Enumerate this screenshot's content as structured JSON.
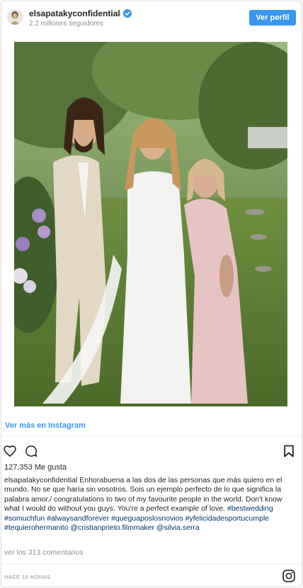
{
  "header": {
    "username": "elsapatakyconfidential",
    "followers": "2.2 millones seguidores",
    "profile_button": "Ver perfil",
    "verified_icon": "verified-badge-icon"
  },
  "post": {
    "view_more": "Ver más en Instagram",
    "likes": "127,353 Me gusta",
    "caption_author": "elsapatakyconfidential",
    "caption_text": "Enhorabuena a las dos de las personas que más quiero en el mundo. No se que haría sin vosotros. Sois un ejemplo perfecto de lo que significa la palabra amor./ congratulations to two of my favourite people in the world. Don't know what I would do without you guys. You're a perfect example of love.",
    "caption_tags": "#bestwedding #somuchfun #alwaysandforever #queguaposlosnovios #yfelicidadesportucumple #tequierohermanito @cristianprieto.filmmaker @silvia.serra",
    "comments": "ver los 313 comentarios",
    "timestamp": "HACE 10 HORAS"
  },
  "icons": {
    "like": "heart-icon",
    "comment": "comment-icon",
    "save": "bookmark-icon",
    "brand": "instagram-icon"
  },
  "colors": {
    "accent": "#3897f0",
    "hashtag": "#003569",
    "muted": "#8e8e8e"
  }
}
